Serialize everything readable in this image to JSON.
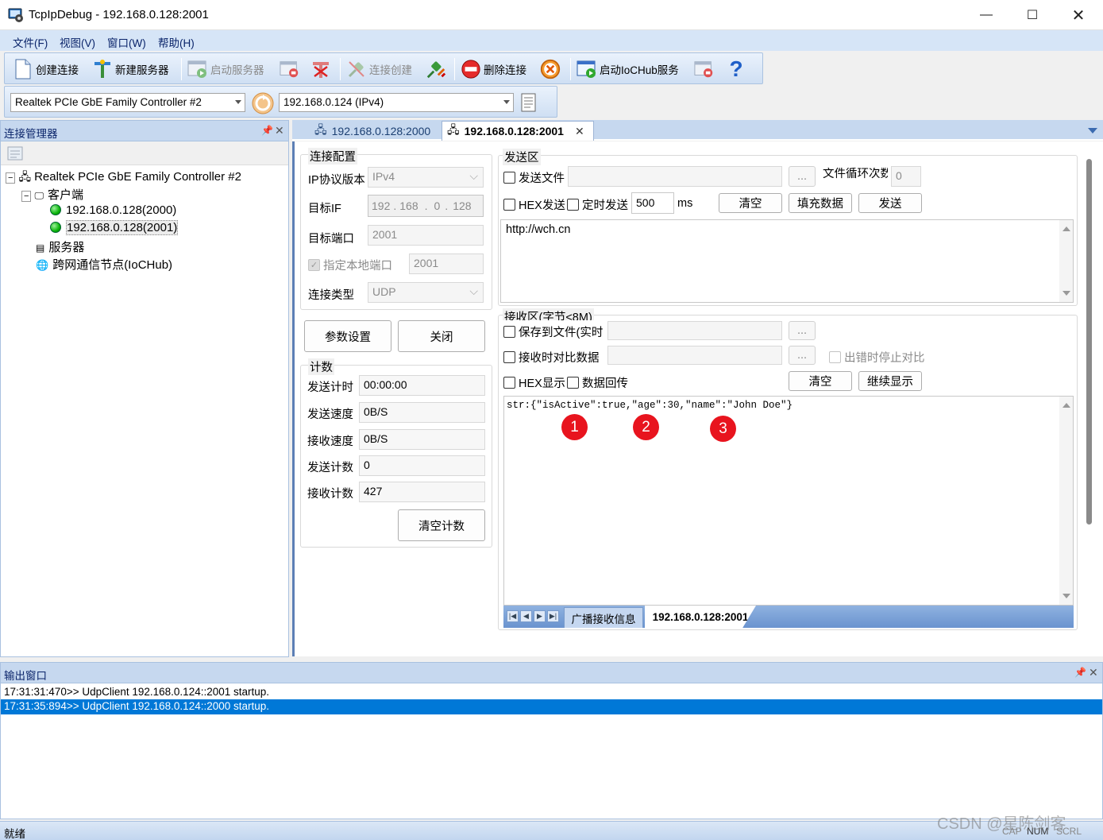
{
  "window": {
    "title": "TcpIpDebug - 192.168.0.128:2001"
  },
  "menu": {
    "file": "文件(F)",
    "view": "视图(V)",
    "window": "窗口(W)",
    "help": "帮助(H)"
  },
  "toolbar1": {
    "create_conn": "创建连接",
    "new_server": "新建服务器",
    "start_server": "启动服务器",
    "conn_create": "连接创建",
    "delete_conn": "删除连接",
    "start_iochub": "启动IoCHub服务"
  },
  "toolbar2": {
    "adapter": "Realtek PCIe GbE Family Controller #2",
    "address": "192.168.0.124 (IPv4)"
  },
  "conn_manager": {
    "title": "连接管理器",
    "tree": {
      "root": "Realtek PCIe GbE Family Controller #2",
      "client": "客户端",
      "conn1": "192.168.0.128(2000)",
      "conn2": "192.168.0.128(2001)",
      "server": "服务器",
      "iochub": "跨网通信节点(IoCHub)"
    }
  },
  "tabs": {
    "tab1": "192.168.0.128:2000",
    "tab2": "192.168.0.128:2001"
  },
  "config": {
    "title": "连接配置",
    "ip_version_label": "IP协议版本",
    "ip_version": "IPv4",
    "target_ip_label": "目标IF",
    "ip1": "192",
    "ip2": "168",
    "ip3": "0",
    "ip4": "128",
    "dot": ".",
    "target_port_label": "目标端口",
    "target_port": "2001",
    "local_port_label": "指定本地端口",
    "local_port": "2001",
    "conn_type_label": "连接类型",
    "conn_type": "UDP",
    "params_btn": "参数设置",
    "close_btn": "关闭"
  },
  "stats": {
    "title": "计数",
    "send_time_label": "发送计时",
    "send_time": "00:00:00",
    "send_speed_label": "发送速度",
    "send_speed": "0B/S",
    "recv_speed_label": "接收速度",
    "recv_speed": "0B/S",
    "send_count_label": "发送计数",
    "send_count": "0",
    "recv_count_label": "接收计数",
    "recv_count": "427",
    "clear_btn": "清空计数"
  },
  "send": {
    "title": "发送区",
    "send_file": "发送文件",
    "browse": "...",
    "file_loop_label": "文件循环次数",
    "file_loop": "0",
    "hex_send": "HEX发送",
    "timed_send": "定时发送",
    "interval": "500",
    "unit": "ms",
    "clear": "清空",
    "fill": "填充数据",
    "send": "发送",
    "content": "http://wch.cn"
  },
  "recv": {
    "title": "接收区(字节<8M)",
    "save_file": "保存到文件(实时",
    "compare": "接收时对比数据",
    "stop_on_error": "出错时停止对比",
    "hex_display": "HEX显示",
    "echo": "数据回传",
    "clear": "清空",
    "continue": "继续显示",
    "content": "str:{\"isActive\":true,\"age\":30,\"name\":\"John Doe\"}",
    "badges": [
      "1",
      "2",
      "3"
    ],
    "tab_broadcast": "广播接收信息",
    "tab_conn": "192.168.0.128:2001"
  },
  "output": {
    "title": "输出窗口",
    "lines": [
      "17:31:31:470>> UdpClient 192.168.0.124::2001 startup.",
      "17:31:35:894>> UdpClient 192.168.0.124::2000 startup."
    ]
  },
  "status": {
    "ready": "就绪",
    "caps": "CAP",
    "num": "NUM",
    "scrl": "SCRL",
    "watermark": "CSDN @星陈剑客"
  },
  "colors": {
    "accent": "#0078d7",
    "panel_header": "#c6d8ef",
    "badge": "#e8141e"
  }
}
